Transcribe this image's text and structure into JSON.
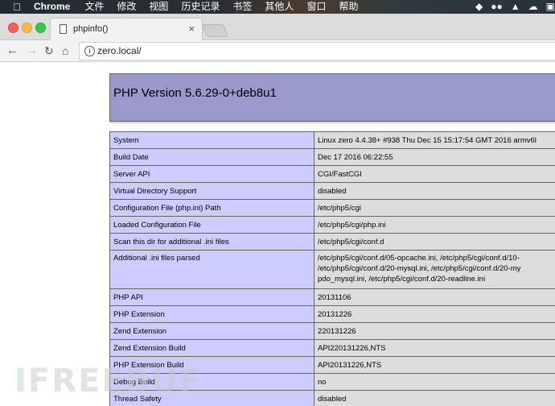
{
  "menubar": {
    "app": "Chrome",
    "items": [
      "文件",
      "修改",
      "视图",
      "历史记录",
      "书签",
      "其他人",
      "窗口",
      "帮助"
    ],
    "tray_icons": [
      "evernote-icon",
      "wechat-icon",
      "qq-icon",
      "cloud-icon"
    ]
  },
  "browser": {
    "tab_title": "phpinfo()",
    "url": "zero.local/"
  },
  "phpinfo": {
    "title": "PHP Version 5.6.29-0+deb8u1",
    "rows": [
      {
        "key": "System",
        "value": "Linux zero 4.4.38+ #938 Thu Dec 15 15:17:54 GMT 2016 armv6l"
      },
      {
        "key": "Build Date",
        "value": "Dec 17 2016 06:22:55"
      },
      {
        "key": "Server API",
        "value": "CGI/FastCGI"
      },
      {
        "key": "Virtual Directory Support",
        "value": "disabled"
      },
      {
        "key": "Configuration File (php.ini) Path",
        "value": "/etc/php5/cgi"
      },
      {
        "key": "Loaded Configuration File",
        "value": "/etc/php5/cgi/php.ini"
      },
      {
        "key": "Scan this dir for additional .ini files",
        "value": "/etc/php5/cgi/conf.d"
      },
      {
        "key": "Additional .ini files parsed",
        "value_lines": [
          "/etc/php5/cgi/conf.d/05-opcache.ini, /etc/php5/cgi/conf.d/10-",
          "/etc/php5/cgi/conf.d/20-mysql.ini, /etc/php5/cgi/conf.d/20-my",
          "pdo_mysql.ini, /etc/php5/cgi/conf.d/20-readline.ini"
        ]
      },
      {
        "key": "PHP API",
        "value": "20131106"
      },
      {
        "key": "PHP Extension",
        "value": "20131226"
      },
      {
        "key": "Zend Extension",
        "value": "220131226"
      },
      {
        "key": "Zend Extension Build",
        "value": "API220131226,NTS"
      },
      {
        "key": "PHP Extension Build",
        "value": "API20131226,NTS"
      },
      {
        "key": "Debug Build",
        "value": "no"
      },
      {
        "key": "Thread Safety",
        "value": "disabled"
      }
    ]
  },
  "watermark": {
    "prefix": "I",
    "text": "FREEBUF"
  }
}
